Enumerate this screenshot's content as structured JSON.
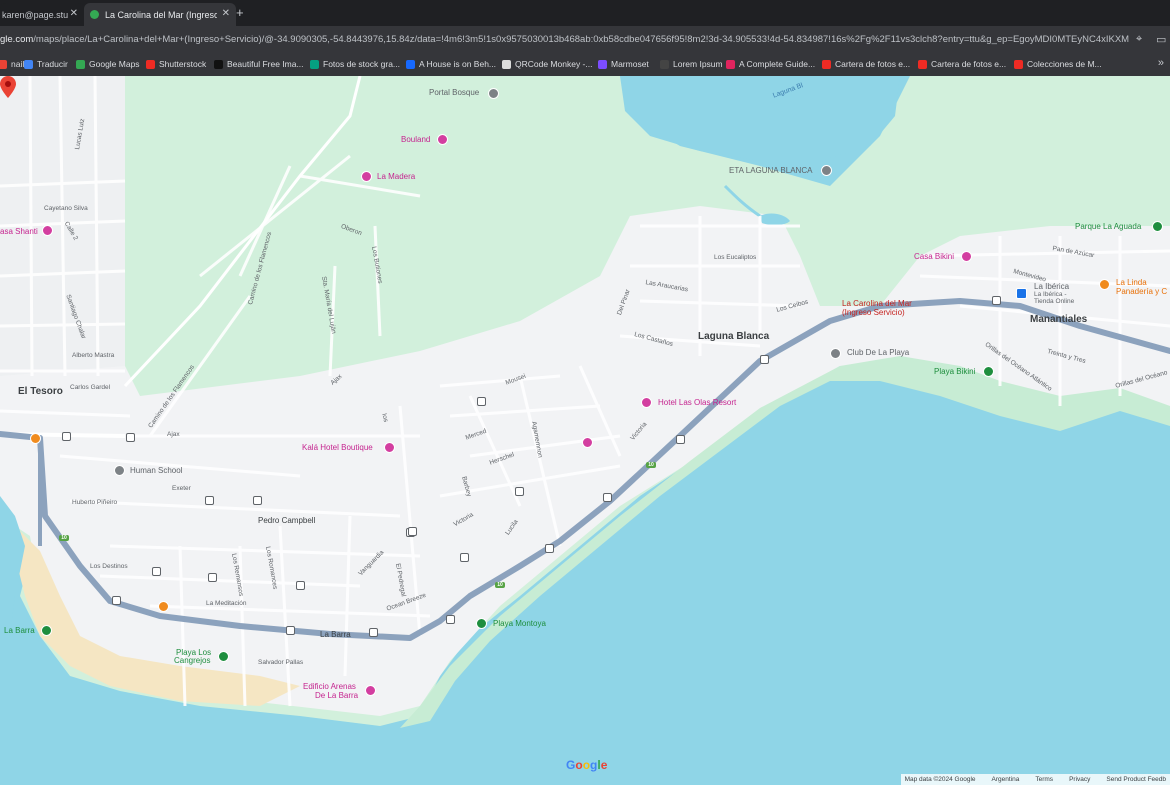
{
  "browser": {
    "tabs": [
      {
        "title": "karen@page.stu",
        "active": false
      },
      {
        "title": "La Carolina del Mar (Ingreso",
        "active": true
      }
    ],
    "new_tab": "+",
    "url_host": "gle.com",
    "url_path": "/maps/place/La+Carolina+del+Mar+(Ingreso+Servicio)/@-34.9090305,-54.8443976,15.84z/data=!4m6!3m5!1s0x9575030013b468ab:0xb58cdbe047656f95!8m2!3d-34.905533!4d-54.834987!16s%2Fg%2F11vs3clch8?entry=ttu&g_ep=EgoyMDI0MTEyNC4xIKXM...",
    "bookmarks": [
      {
        "label": "nail",
        "color": "#ea4335"
      },
      {
        "label": "Traducir",
        "color": "#4285f4"
      },
      {
        "label": "Google Maps",
        "color": "#34a853"
      },
      {
        "label": "Shutterstock",
        "color": "#ee2b24"
      },
      {
        "label": "Beautiful Free Ima...",
        "color": "#111111"
      },
      {
        "label": "Fotos de stock gra...",
        "color": "#05a081"
      },
      {
        "label": "A House is on Beh...",
        "color": "#1769ff"
      },
      {
        "label": "QRCode Monkey -...",
        "color": "#dddddd"
      },
      {
        "label": "Marmoset",
        "color": "#7c4dff"
      },
      {
        "label": "Lorem Ipsum",
        "color": "#444444"
      },
      {
        "label": "A Complete Guide...",
        "color": "#e0245e"
      },
      {
        "label": "Cartera de fotos e...",
        "color": "#ee2b24"
      },
      {
        "label": "Cartera de fotos e...",
        "color": "#ee2b24"
      },
      {
        "label": "Colecciones de M...",
        "color": "#ee2b24"
      }
    ],
    "bookmarks_more": "»"
  },
  "map": {
    "colors": {
      "water": "#8fd5e7",
      "land": "#f2f3f5",
      "green": "#d2f0dc",
      "sand": "#f5e6c3",
      "highway": "#8ca2bd",
      "road": "#cdd3dc",
      "pin": "#ea4335",
      "poi_pink": "#c5248f",
      "poi_green": "#1e8e3e"
    },
    "areas": [
      {
        "id": "el-tesoro",
        "text": "El Tesoro"
      },
      {
        "id": "laguna-blanca",
        "text": "Laguna Blanca"
      },
      {
        "id": "manantiales",
        "text": "Manantiales"
      },
      {
        "id": "la-barra-road",
        "text": "La Barra"
      }
    ],
    "selected_place": {
      "name": "La Carolina del Mar",
      "subtitle": "(Ingreso Servicio)"
    },
    "pois": [
      {
        "id": "portal-bosque",
        "text": "Portal Bosque",
        "kind": "grey"
      },
      {
        "id": "bouland",
        "text": "Bouland",
        "kind": "pink"
      },
      {
        "id": "la-madera",
        "text": "La Madera",
        "kind": "pink"
      },
      {
        "id": "casa-shanti",
        "text": "asa Shanti",
        "kind": "pink"
      },
      {
        "id": "eta-laguna-blanca",
        "text": "ETA LAGUNA BLANCA",
        "kind": "grey"
      },
      {
        "id": "parque-la-aguada",
        "text": "Parque La Aguada",
        "kind": "green"
      },
      {
        "id": "casa-bikini",
        "text": "Casa Bikini",
        "kind": "pink"
      },
      {
        "id": "la-iberica",
        "text": "La Ibérica",
        "kind": "blue"
      },
      {
        "id": "la-iberica-sub",
        "text": "La Ibérica -",
        "kind": "sub"
      },
      {
        "id": "la-iberica-sub2",
        "text": "Tienda Online",
        "kind": "sub"
      },
      {
        "id": "la-linda",
        "text": "La Linda",
        "kind": "orange"
      },
      {
        "id": "la-linda-2",
        "text": "Panadería y C",
        "kind": "orange"
      },
      {
        "id": "club-de-la-playa",
        "text": "Club De La Playa",
        "kind": "grey"
      },
      {
        "id": "playa-bikini",
        "text": "Playa Bikini",
        "kind": "green"
      },
      {
        "id": "hotel-las-olas",
        "text": "Hotel Las Olas Resort",
        "kind": "pink"
      },
      {
        "id": "kala-hotel",
        "text": "Kalá Hotel Boutique",
        "kind": "pink"
      },
      {
        "id": "human-school",
        "text": "Human School",
        "kind": "grey"
      },
      {
        "id": "playa-montoya",
        "text": "Playa Montoya",
        "kind": "green"
      },
      {
        "id": "la-barra-poi",
        "text": "La Barra",
        "kind": "green"
      },
      {
        "id": "playa-los-cangrejos",
        "text": "Playa Los",
        "kind": "green"
      },
      {
        "id": "playa-los-cangrejos-2",
        "text": "Cangrejos",
        "kind": "green"
      },
      {
        "id": "edificio-arenas",
        "text": "Edificio Arenas",
        "kind": "pink"
      },
      {
        "id": "edificio-arenas-2",
        "text": "De La Barra",
        "kind": "pink"
      }
    ],
    "streets": [
      {
        "id": "s-laguna-blanca-water",
        "text": "Laguna Bl"
      },
      {
        "id": "s-lucas-luiz",
        "text": "Lucas Luiz"
      },
      {
        "id": "s-cayetano-silva",
        "text": "Cayetano Silva"
      },
      {
        "id": "s-calle-2",
        "text": "Calle 2"
      },
      {
        "id": "s-santiago-chalar",
        "text": "Santiago Chalar"
      },
      {
        "id": "s-alberto-mastra",
        "text": "Alberto Mastra"
      },
      {
        "id": "s-carlos-gardel",
        "text": "Carlos Gardel"
      },
      {
        "id": "s-oberon",
        "text": "Oberon"
      },
      {
        "id": "s-camino-flamencos",
        "text": "Camino de los Flamencos"
      },
      {
        "id": "s-sta-maria",
        "text": "Sta. María del Luján"
      },
      {
        "id": "s-los-butiones",
        "text": "Los Butiones"
      },
      {
        "id": "s-camino-flamencos-2",
        "text": "Camino de los Flamencos"
      },
      {
        "id": "s-ajax",
        "text": "Ajax"
      },
      {
        "id": "s-ajax-2",
        "text": "Ajax"
      },
      {
        "id": "s-exeter",
        "text": "Exeter"
      },
      {
        "id": "s-hubelo",
        "text": "Huberto Piñeiro"
      },
      {
        "id": "s-pedro-campbell",
        "text": "Pedro Campbell"
      },
      {
        "id": "s-los-destinos",
        "text": "Los Destinos"
      },
      {
        "id": "s-la-meditacion",
        "text": "La Meditación"
      },
      {
        "id": "s-los-romances",
        "text": "Los Romances"
      },
      {
        "id": "s-los-remansos",
        "text": "Los Remansos"
      },
      {
        "id": "s-vanguardia",
        "text": "Vanguardia"
      },
      {
        "id": "s-el-pedregal",
        "text": "El Pedregal"
      },
      {
        "id": "s-ocean-breeze",
        "text": "Ocean Breeze"
      },
      {
        "id": "s-salvador-pallas",
        "text": "Salvador Pallas"
      },
      {
        "id": "s-mousei",
        "text": "Mousei"
      },
      {
        "id": "s-merced",
        "text": "Merced"
      },
      {
        "id": "s-herschel",
        "text": "Herschel"
      },
      {
        "id": "s-barbey",
        "text": "Barbey"
      },
      {
        "id": "s-agamemnon",
        "text": "Agamemnon"
      },
      {
        "id": "s-victoria",
        "text": "Victoria"
      },
      {
        "id": "s-victoria-2",
        "text": "Victoria"
      },
      {
        "id": "s-lucila",
        "text": "Lucila"
      },
      {
        "id": "s-ios",
        "text": "Ios"
      },
      {
        "id": "s-los-eucaliptos",
        "text": "Los Eucaliptos"
      },
      {
        "id": "s-las-araucarias",
        "text": "Las Araucarias"
      },
      {
        "id": "s-del-pinar",
        "text": "Del Pinar"
      },
      {
        "id": "s-los-ceibos",
        "text": "Los Ceibos"
      },
      {
        "id": "s-los-castanos",
        "text": "Los Castaños"
      },
      {
        "id": "s-pan-de-azucar",
        "text": "Pan de Azúcar"
      },
      {
        "id": "s-montevideo",
        "text": "Montevideo"
      },
      {
        "id": "s-orillas-1",
        "text": "Orillas del Océano Atlántico"
      },
      {
        "id": "s-orillas-2",
        "text": "Orillas del Océano"
      },
      {
        "id": "s-treinta-y-tres",
        "text": "Treinta y Tres"
      }
    ],
    "route_shield": "10",
    "attribution": [
      "Map data ©2024 Google",
      "Argentina",
      "Terms",
      "Privacy",
      "Send Product Feedb"
    ],
    "logo": "Google"
  }
}
